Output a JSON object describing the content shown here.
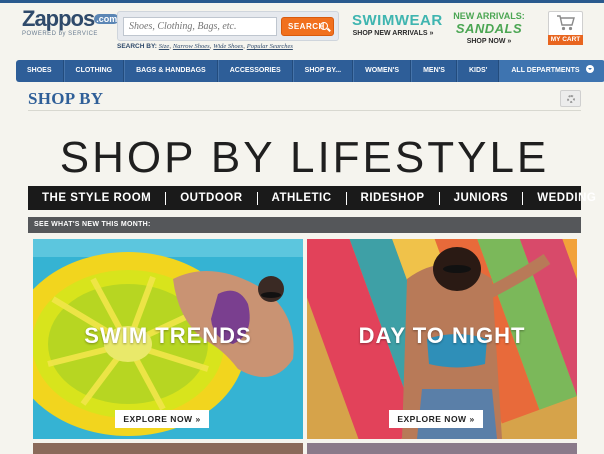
{
  "header": {
    "logo_brand": "Zappos",
    "logo_dotcom": ".com",
    "logo_tagline": "POWERED by SERVICE",
    "search_placeholder": "Shoes, Clothing, Bags, etc.",
    "search_button": "SEARCH",
    "search_by_label": "SEARCH BY:",
    "search_by_links": [
      "Size",
      "Narrow Shoes",
      "Wide Shoes",
      "Popular Searches"
    ],
    "promo_swimwear_title": "SWIMWEAR",
    "promo_swimwear_cta": "SHOP NEW ARRIVALS »",
    "promo_sandals_line1": "NEW ARRIVALS:",
    "promo_sandals_line2": "SANDALS",
    "promo_sandals_cta": "SHOP NOW »",
    "cart_label": "MY CART"
  },
  "nav": {
    "items": [
      "SHOES",
      "CLOTHING",
      "BAGS & HANDBAGS",
      "ACCESSORIES",
      "SHOP BY...",
      "WOMEN'S",
      "MEN'S",
      "KIDS'"
    ],
    "all_departments": "ALL DEPARTMENTS"
  },
  "page": {
    "section_title": "SHOP BY",
    "hero_title": "SHOP BY LIFESTYLE",
    "lifestyle_tabs": [
      "THE STYLE ROOM",
      "OUTDOOR",
      "ATHLETIC",
      "RIDESHOP",
      "JUNIORS",
      "WEDDING"
    ],
    "whats_new_label": "SEE WHAT'S NEW THIS MONTH:"
  },
  "panels": [
    {
      "caption": "SWIM TRENDS",
      "cta": "EXPLORE NOW »"
    },
    {
      "caption": "DAY TO NIGHT",
      "cta": "EXPLORE NOW »"
    }
  ],
  "colors": {
    "nav_blue": "#2e5e98",
    "search_orange": "#f1701e",
    "swimwear_teal": "#3fb5b0",
    "sandals_green": "#4ba653",
    "title_blue": "#2f5f98"
  }
}
